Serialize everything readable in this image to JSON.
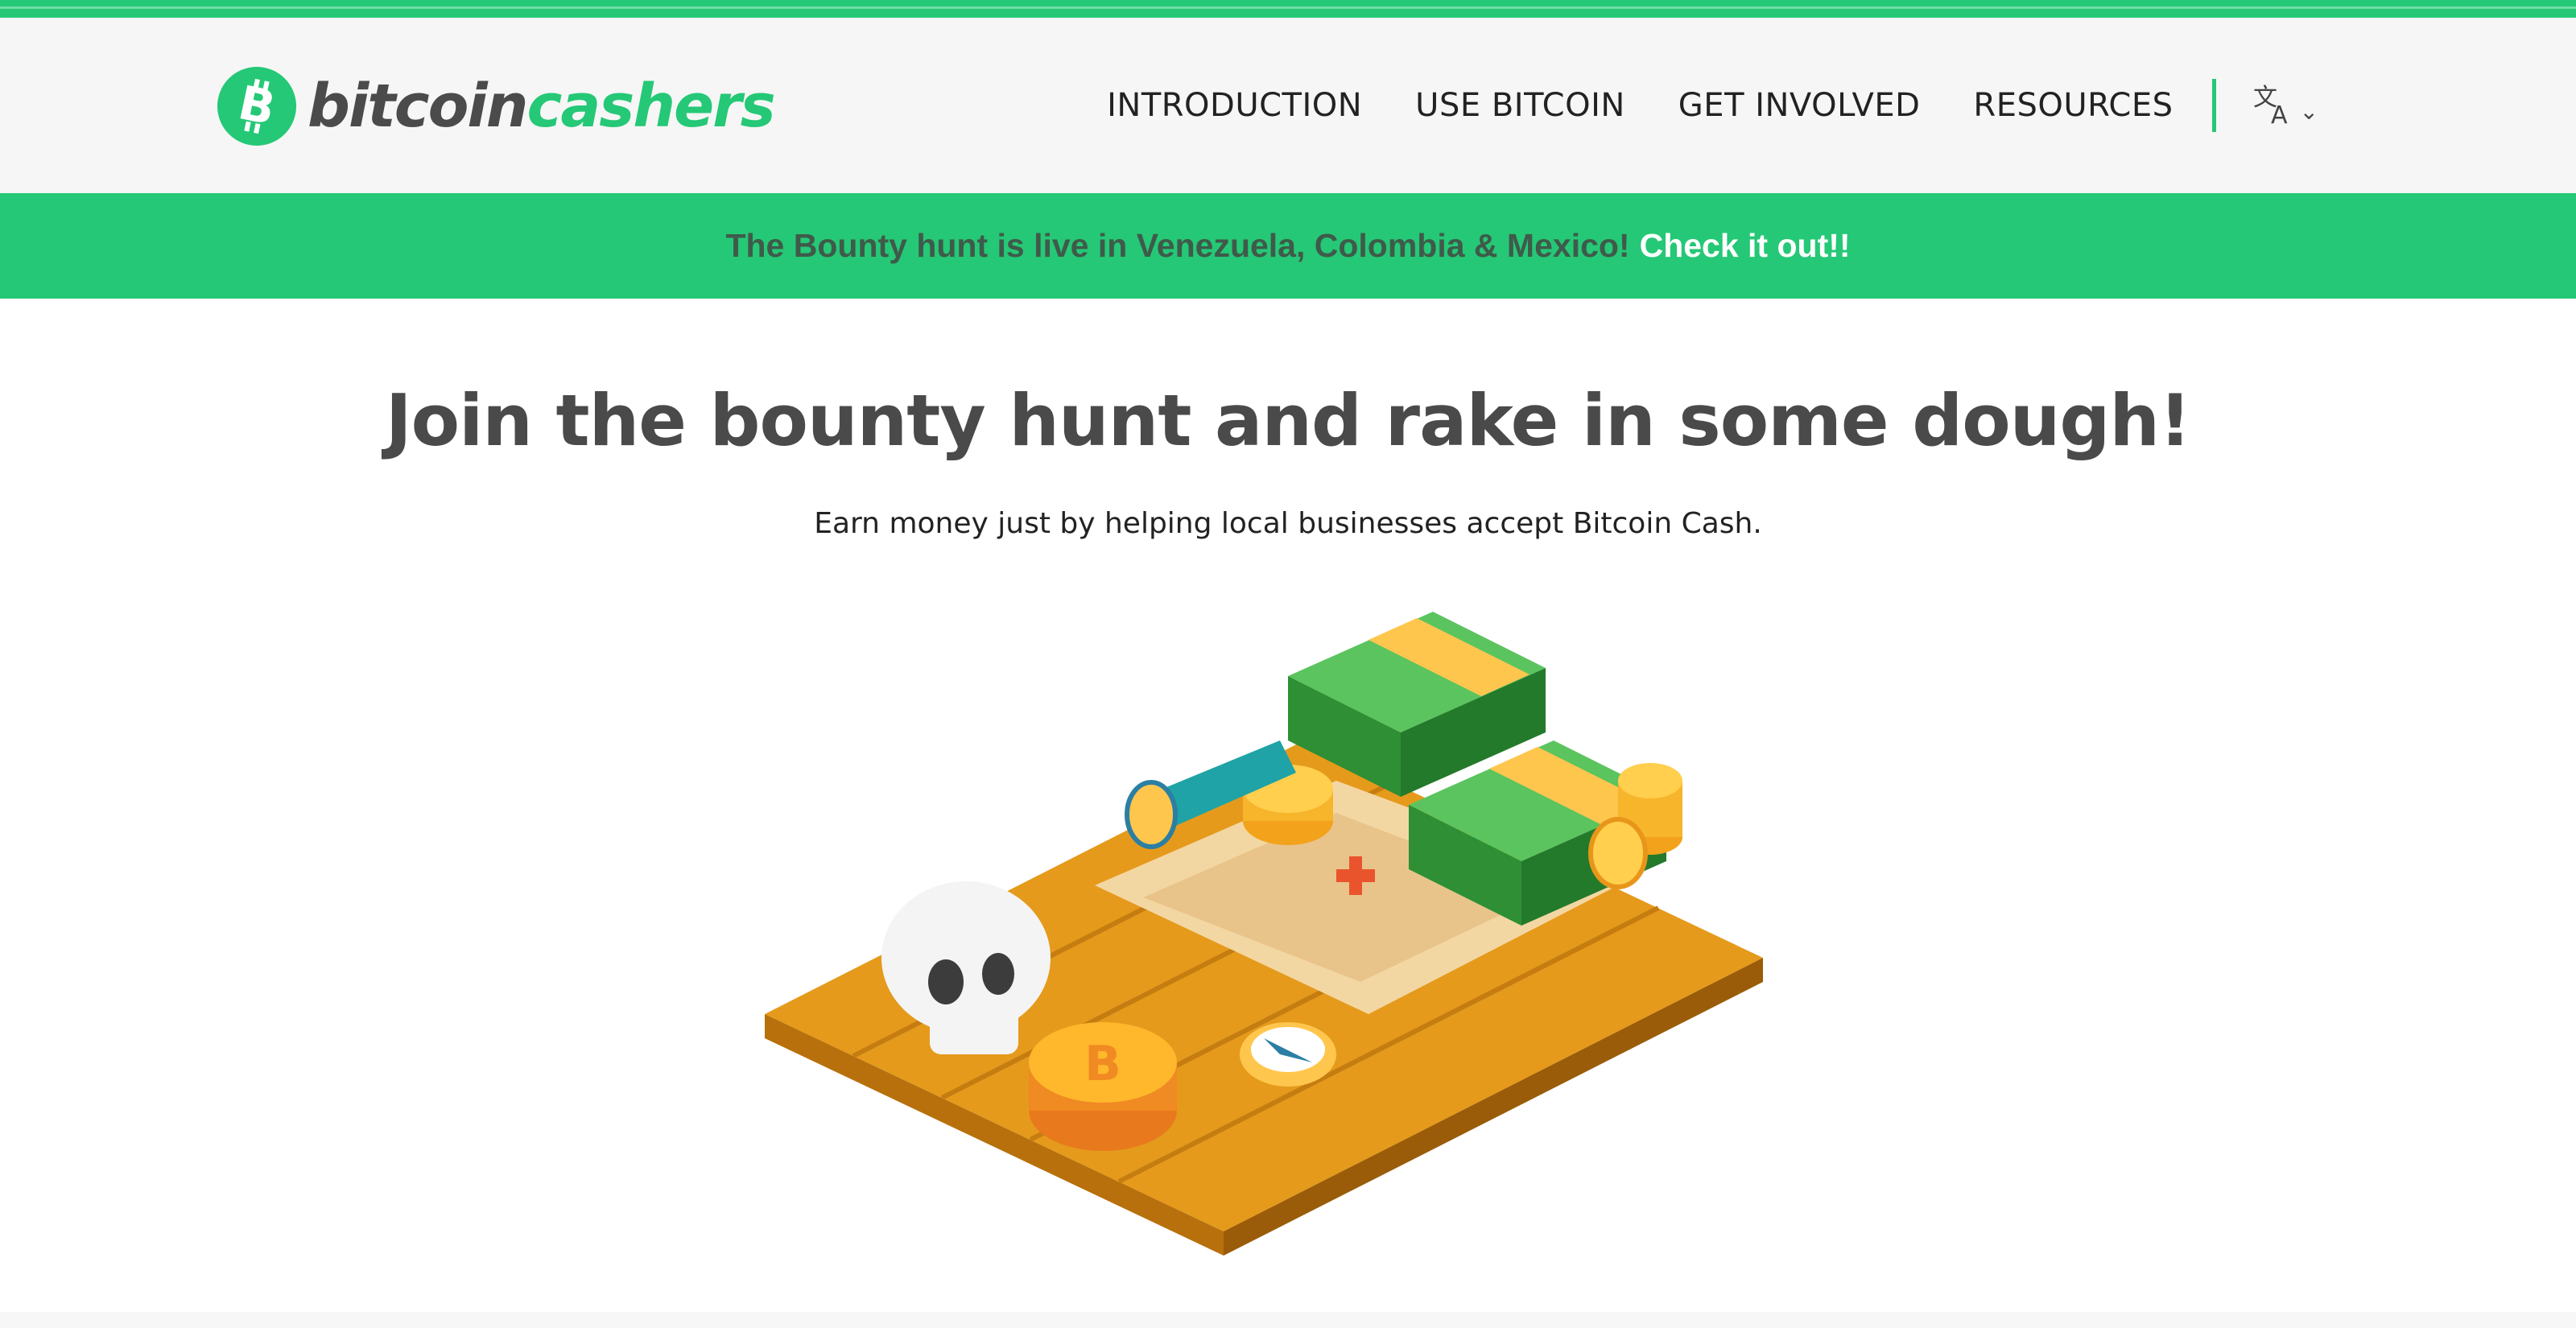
{
  "brand": {
    "name_part1": "bitcoin",
    "name_part2": "cashers",
    "accent_color": "#25c876"
  },
  "nav": {
    "items": [
      {
        "label": "INTRODUCTION"
      },
      {
        "label": "USE BITCOIN"
      },
      {
        "label": "GET INVOLVED"
      },
      {
        "label": "RESOURCES"
      }
    ],
    "language_icon": "translate-icon"
  },
  "banner": {
    "text": "The Bounty hunt is live in Venezuela, Colombia & Mexico!",
    "link_label": "Check it out!!"
  },
  "hero": {
    "title": "Join the bounty hunt and rake in some dough!",
    "subtitle": "Earn money just by helping local businesses accept Bitcoin Cash."
  },
  "illustration": {
    "icon": "treasure-map-illustration"
  }
}
